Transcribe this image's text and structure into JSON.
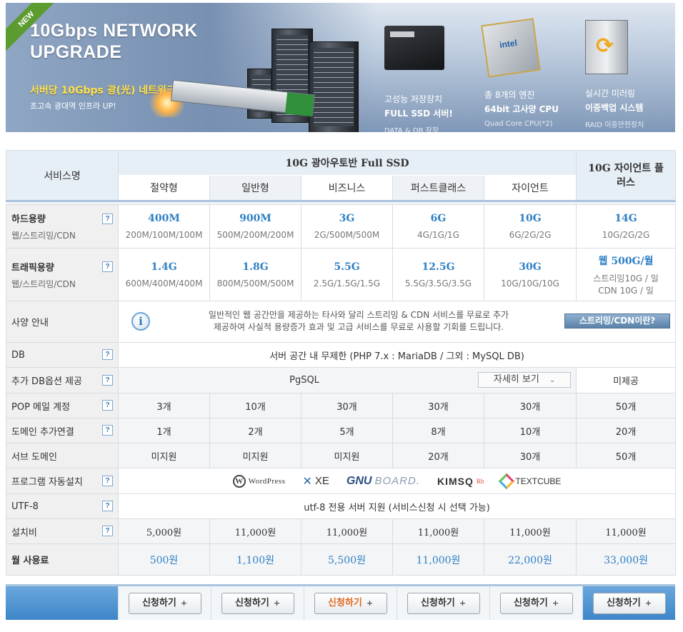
{
  "banner": {
    "badge": "NEW",
    "headline_line1": "10Gbps NETWORK",
    "headline_line2": "UPGRADE",
    "sub1": "서버당 10Gbps 광(光) 네트워크",
    "sub2": "초고속 광대역 인프라 UP!",
    "features": [
      {
        "line1": "고성능 저장장치",
        "line2": "FULL SSD 서버!",
        "line3": "DATA & DB 장착"
      },
      {
        "line1": "총 8개의 엔진",
        "line2": "64bit 고사양 CPU",
        "line3": "Quad Core CPU(*2)"
      },
      {
        "line1": "실시간 미러링",
        "line2": "이중백업 시스템",
        "line3": "RAID 이중안전장치"
      }
    ]
  },
  "table": {
    "service_name_header": "서비스명",
    "group_title": "10G 광아우토반 Full SSD",
    "giant_plus": "10G 자이언트 플러스",
    "plans": [
      "절약형",
      "일반형",
      "비즈니스",
      "퍼스트클래스",
      "자이언트"
    ],
    "help_icon": "?",
    "rows": {
      "disk": {
        "label": "하드용량",
        "sub": "웹/스트리밍/CDN",
        "values": [
          "400M",
          "900M",
          "3G",
          "6G",
          "10G",
          "14G"
        ],
        "details": [
          "200M/100M/100M",
          "500M/200M/200M",
          "2G/500M/500M",
          "4G/1G/1G",
          "6G/2G/2G",
          "10G/2G/2G"
        ]
      },
      "traffic": {
        "label": "트래픽용량",
        "sub": "웹/스트리밍/CDN",
        "values": [
          "1.4G",
          "1.8G",
          "5.5G",
          "12.5G",
          "30G",
          "웹 500G/월"
        ],
        "details": [
          "600M/400M/400M",
          "800M/500M/500M",
          "2.5G/1.5G/1.5G",
          "5.5G/3.5G/3.5G",
          "10G/10G/10G"
        ],
        "giant_detail_line1": "스트리밍10G / 일",
        "giant_detail_line2": "CDN 10G / 일"
      },
      "spec": {
        "label": "사양 안내",
        "info_icon": "i",
        "text_line1": "일반적인 웹 공간만을 제공하는 타사와 달리 스트리밍 & CDN 서비스를 무료로 추가",
        "text_line2": "제공하여 사실적 용량증가 효과 및 고급 서비스를 무료로 사용할 기회를 드립니다.",
        "button": "스트리밍/CDN이란?"
      },
      "db": {
        "label": "DB",
        "value": "서버 공간 내 무제한 (PHP 7.x : MariaDB / 그외 : MySQL DB)"
      },
      "extra_db": {
        "label": "추가 DB옵션 제공",
        "value": "PgSQL",
        "button": "자세히 보기",
        "giant": "미제공"
      },
      "pop": {
        "label": "POP 메일 계정",
        "values": [
          "3개",
          "10개",
          "30개",
          "30개",
          "30개",
          "50개"
        ]
      },
      "domain": {
        "label": "도메인 추가연결",
        "values": [
          "1개",
          "2개",
          "5개",
          "8개",
          "10개",
          "20개"
        ]
      },
      "subdomain": {
        "label": "서브 도메인",
        "values": [
          "미지원",
          "미지원",
          "미지원",
          "20개",
          "30개",
          "50개"
        ]
      },
      "programs": {
        "label": "프로그램 자동설치",
        "logos": {
          "wordpress": "WordPress",
          "xe": "XE",
          "gnu1": "GNU",
          "gnu2": "BOARD.",
          "kimsq": "KIMSQ",
          "kimsq_sup": "Rb",
          "textcube": "TEXTCUBE"
        }
      },
      "utf8": {
        "label": "UTF-8",
        "value": "utf-8 전용 서버 지원 (서비스신청 시 선택 가능)"
      },
      "setup": {
        "label": "설치비",
        "values": [
          "5,000원",
          "11,000원",
          "11,000원",
          "11,000원",
          "11,000원",
          "11,000원"
        ]
      },
      "monthly": {
        "label": "월 사용료",
        "values": [
          "500원",
          "1,100원",
          "5,500원",
          "11,000원",
          "22,000원",
          "33,000원"
        ]
      }
    }
  },
  "footer": {
    "apply_label": "신청하기",
    "plus": "+"
  },
  "colors": {
    "accent_blue": "#2f80c4",
    "header_bg": "#e6eef6",
    "highlight_orange": "#e0671e"
  }
}
